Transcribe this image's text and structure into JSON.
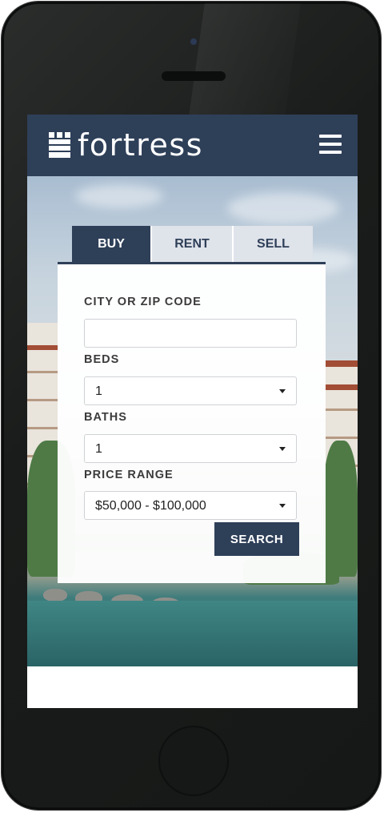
{
  "brand": {
    "name": "fortress"
  },
  "header": {
    "menu_icon": "hamburger-menu-icon"
  },
  "search": {
    "tabs": [
      {
        "label": "BUY",
        "active": true
      },
      {
        "label": "RENT",
        "active": false
      },
      {
        "label": "SELL",
        "active": false
      }
    ],
    "city_label": "CITY OR ZIP CODE",
    "city_value": "",
    "beds_label": "BEDS",
    "beds_value": "1",
    "baths_label": "BATHS",
    "baths_value": "1",
    "price_label": "PRICE RANGE",
    "price_value": "$50,000 - $100,000",
    "submit_label": "SEARCH"
  },
  "colors": {
    "brand_navy": "#2e3f58",
    "tab_inactive": "#dfe3ea",
    "white": "#ffffff"
  }
}
